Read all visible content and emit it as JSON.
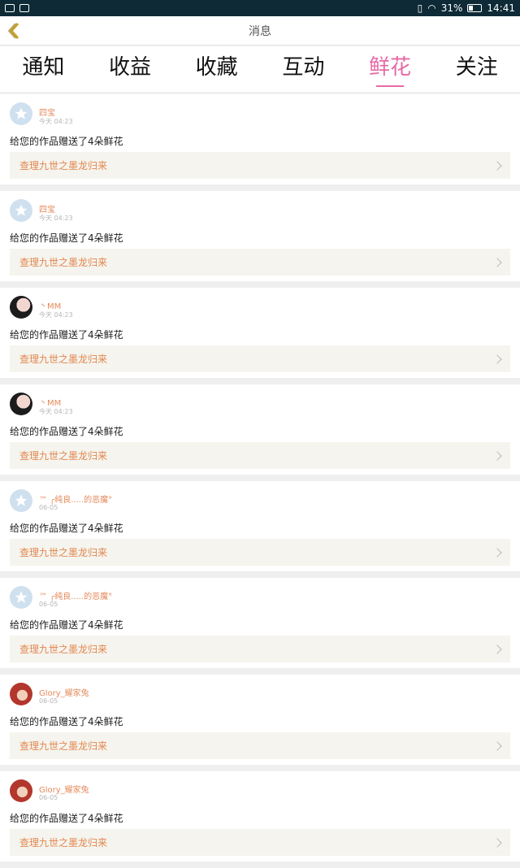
{
  "status_bar": {
    "battery_percent": "31%",
    "time": "14:41"
  },
  "header": {
    "title": "消息"
  },
  "tabs": [
    {
      "label": "通知",
      "active": false
    },
    {
      "label": "收益",
      "active": false
    },
    {
      "label": "收藏",
      "active": false
    },
    {
      "label": "互动",
      "active": false
    },
    {
      "label": "鲜花",
      "active": true
    },
    {
      "label": "关注",
      "active": false
    }
  ],
  "notifications": [
    {
      "user": "四宝",
      "time": "今天 04:23",
      "message": "给您的作品赠送了4朵鲜花",
      "action": "查理九世之墨龙归来",
      "avatar": "star"
    },
    {
      "user": "四宝",
      "time": "今天 04:23",
      "message": "给您的作品赠送了4朵鲜花",
      "action": "查理九世之墨龙归来",
      "avatar": "star"
    },
    {
      "user": "丶MM",
      "time": "今天 04:23",
      "message": "给您的作品赠送了4朵鲜花",
      "action": "查理九世之墨龙归来",
      "avatar": "girl"
    },
    {
      "user": "丶MM",
      "time": "今天 04:23",
      "message": "给您的作品赠送了4朵鲜花",
      "action": "查理九世之墨龙归来",
      "avatar": "girl"
    },
    {
      "user": "™ ╭纯良.....的恶魔°",
      "time": "06-05",
      "message": "给您的作品赠送了4朵鲜花",
      "action": "查理九世之墨龙归来",
      "avatar": "star"
    },
    {
      "user": "™ ╭纯良.....的恶魔°",
      "time": "06-05",
      "message": "给您的作品赠送了4朵鲜花",
      "action": "查理九世之墨龙归来",
      "avatar": "star"
    },
    {
      "user": "Glory_耀家兔",
      "time": "06-05",
      "message": "给您的作品赠送了4朵鲜花",
      "action": "查理九世之墨龙归来",
      "avatar": "red"
    },
    {
      "user": "Glory_耀家兔",
      "time": "06-05",
      "message": "给您的作品赠送了4朵鲜花",
      "action": "查理九世之墨龙归来",
      "avatar": "red"
    }
  ],
  "colors": {
    "accent_pink": "#e76aa6",
    "username_orange": "#e58a5c",
    "action_text_orange": "#e2874f",
    "action_bg": "#f5f4ee"
  },
  "icons": {
    "back": "chevron-left-icon",
    "chevron": "chevron-right-icon"
  }
}
